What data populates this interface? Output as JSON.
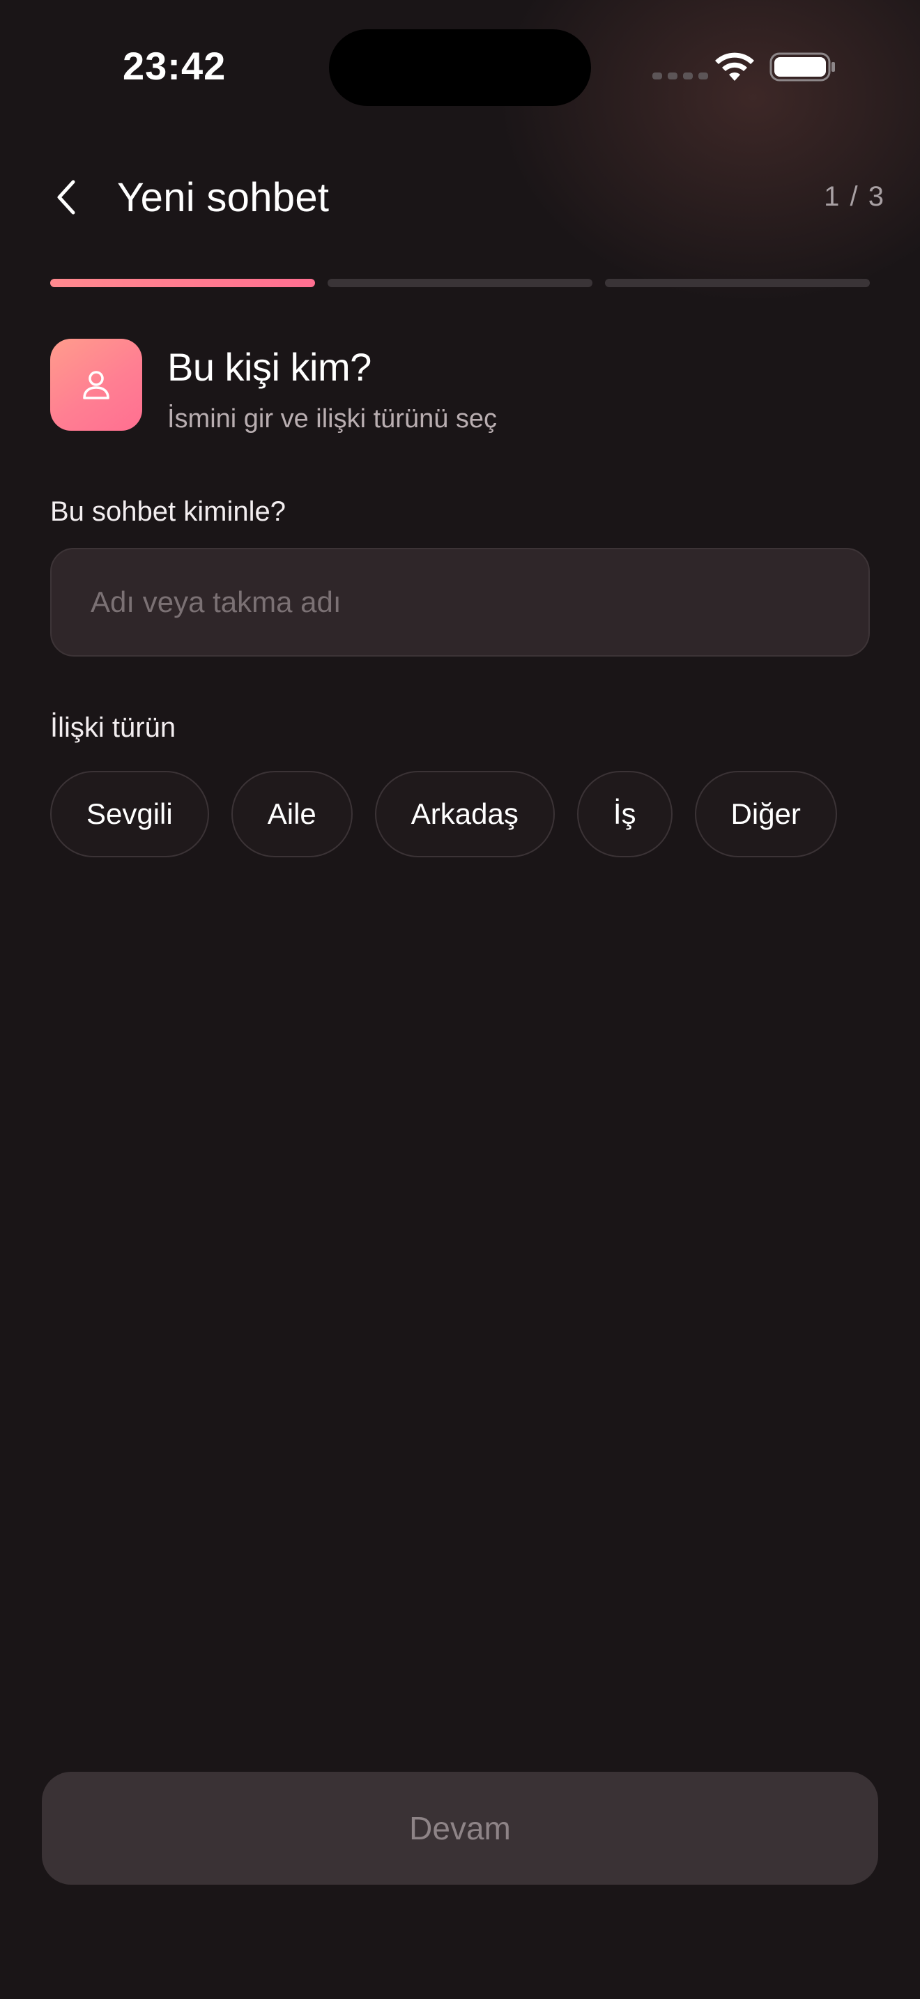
{
  "status_bar": {
    "time": "23:42"
  },
  "header": {
    "title": "Yeni sohbet",
    "step": "1 / 3"
  },
  "progress": {
    "current_step": 1,
    "total_steps": 3
  },
  "section": {
    "title": "Bu kişi kim?",
    "subtitle": "İsmini gir ve ilişki türünü seç",
    "icon": "person-icon"
  },
  "name_field": {
    "label": "Bu sohbet kiminle?",
    "placeholder": "Adı veya takma adı",
    "value": ""
  },
  "relationship": {
    "label": "İlişki türün",
    "options": [
      "Sevgili",
      "Aile",
      "Arkadaş",
      "İş",
      "Diğer"
    ]
  },
  "footer": {
    "continue_label": "Devam"
  },
  "colors": {
    "background": "#1a1517",
    "accent": "#ff7f92",
    "field_bg": "#2f2629",
    "button_bg": "#3a3235"
  }
}
